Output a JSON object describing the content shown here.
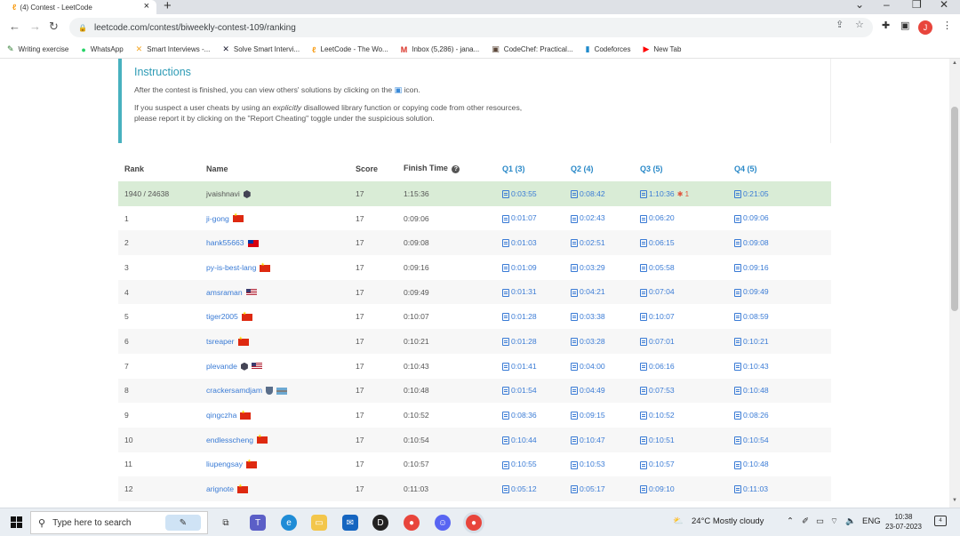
{
  "browser": {
    "tab_title": "(4) Contest - LeetCode",
    "url": "leetcode.com/contest/biweekly-contest-109/ranking",
    "avatar_letter": "J",
    "bookmarks": [
      {
        "label": "Writing exercise",
        "icon": "pencil-icon",
        "color": "#2e7d32"
      },
      {
        "label": "WhatsApp",
        "icon": "whatsapp-icon",
        "color": "#25d366"
      },
      {
        "label": "Smart Interviews -...",
        "icon": "smart-interviews-icon",
        "color": "#f5a623"
      },
      {
        "label": "Solve Smart Intervi...",
        "icon": "smart-interviews-icon",
        "color": "#1a1a2e"
      },
      {
        "label": "LeetCode - The Wo...",
        "icon": "leetcode-icon",
        "color": "#f89f1b"
      },
      {
        "label": "Inbox (5,286) - jana...",
        "icon": "gmail-icon",
        "color": "#d93025"
      },
      {
        "label": "CodeChef: Practical...",
        "icon": "codechef-icon",
        "color": "#5b4638"
      },
      {
        "label": "Codeforces",
        "icon": "codeforces-icon",
        "color": "#1f8acb"
      },
      {
        "label": "New Tab",
        "icon": "youtube-icon",
        "color": "#ff0000"
      }
    ]
  },
  "instructions": {
    "title": "Instructions",
    "line1_before": "After the contest is finished, you can view others' solutions by clicking on the",
    "line1_after": "icon.",
    "line2_a": "If you suspect a user cheats by using an",
    "line2_em": "explicitly",
    "line2_b": "disallowed library function or copying code from other resources,",
    "line3": "please report it by clicking on the \"Report Cheating\" toggle under the suspicious solution."
  },
  "table": {
    "headers": {
      "rank": "Rank",
      "name": "Name",
      "score": "Score",
      "finish": "Finish Time",
      "q1": "Q1 (3)",
      "q2": "Q2 (4)",
      "q3": "Q3 (5)",
      "q4": "Q4 (5)"
    },
    "rows": [
      {
        "rank": "1940 / 24638",
        "name": "jvaishnavi",
        "badge": "hex",
        "flag": "",
        "score": "17",
        "finish": "1:15:36",
        "q1": "0:03:55",
        "q2": "0:08:42",
        "q3": "1:10:36",
        "q3_bugs": "1",
        "q4": "0:21:05",
        "me": true
      },
      {
        "rank": "1",
        "name": "ji-gong",
        "flag": "cn",
        "score": "17",
        "finish": "0:09:06",
        "q1": "0:01:07",
        "q2": "0:02:43",
        "q3": "0:06:20",
        "q4": "0:09:06"
      },
      {
        "rank": "2",
        "name": "hank55663",
        "flag": "tw",
        "score": "17",
        "finish": "0:09:08",
        "q1": "0:01:03",
        "q2": "0:02:51",
        "q3": "0:06:15",
        "q4": "0:09:08"
      },
      {
        "rank": "3",
        "name": "py-is-best-lang",
        "flag": "cn",
        "score": "17",
        "finish": "0:09:16",
        "q1": "0:01:09",
        "q2": "0:03:29",
        "q3": "0:05:58",
        "q4": "0:09:16"
      },
      {
        "rank": "4",
        "name": "amsraman",
        "flag": "us",
        "score": "17",
        "finish": "0:09:49",
        "q1": "0:01:31",
        "q2": "0:04:21",
        "q3": "0:07:04",
        "q4": "0:09:49"
      },
      {
        "rank": "5",
        "name": "tiger2005",
        "flag": "cn",
        "score": "17",
        "finish": "0:10:07",
        "q1": "0:01:28",
        "q2": "0:03:38",
        "q3": "0:10:07",
        "q4": "0:08:59"
      },
      {
        "rank": "6",
        "name": "tsreaper",
        "flag": "cn",
        "score": "17",
        "finish": "0:10:21",
        "q1": "0:01:28",
        "q2": "0:03:28",
        "q3": "0:07:01",
        "q4": "0:10:21"
      },
      {
        "rank": "7",
        "name": "plevande",
        "badge": "hex",
        "flag": "us",
        "score": "17",
        "finish": "0:10:43",
        "q1": "0:01:41",
        "q2": "0:04:00",
        "q3": "0:06:16",
        "q4": "0:10:43"
      },
      {
        "rank": "8",
        "name": "crackersamdjam",
        "badge": "shield",
        "flag": "bw",
        "score": "17",
        "finish": "0:10:48",
        "q1": "0:01:54",
        "q2": "0:04:49",
        "q3": "0:07:53",
        "q4": "0:10:48"
      },
      {
        "rank": "9",
        "name": "qingczha",
        "flag": "cn",
        "score": "17",
        "finish": "0:10:52",
        "q1": "0:08:36",
        "q2": "0:09:15",
        "q3": "0:10:52",
        "q4": "0:08:26"
      },
      {
        "rank": "10",
        "name": "endlesscheng",
        "flag": "cn",
        "score": "17",
        "finish": "0:10:54",
        "q1": "0:10:44",
        "q2": "0:10:47",
        "q3": "0:10:51",
        "q4": "0:10:54"
      },
      {
        "rank": "11",
        "name": "liupengsay",
        "flag": "cn",
        "score": "17",
        "finish": "0:10:57",
        "q1": "0:10:55",
        "q2": "0:10:53",
        "q3": "0:10:57",
        "q4": "0:10:48"
      },
      {
        "rank": "12",
        "name": "arignote",
        "flag": "cn",
        "score": "17",
        "finish": "0:11:03",
        "q1": "0:05:12",
        "q2": "0:05:17",
        "q3": "0:09:10",
        "q4": "0:11:03"
      }
    ]
  },
  "taskbar": {
    "search_placeholder": "Type here to search",
    "weather": "24°C  Mostly cloudy",
    "lang": "ENG",
    "time": "10:38",
    "date": "23-07-2023",
    "notifications": "4"
  }
}
